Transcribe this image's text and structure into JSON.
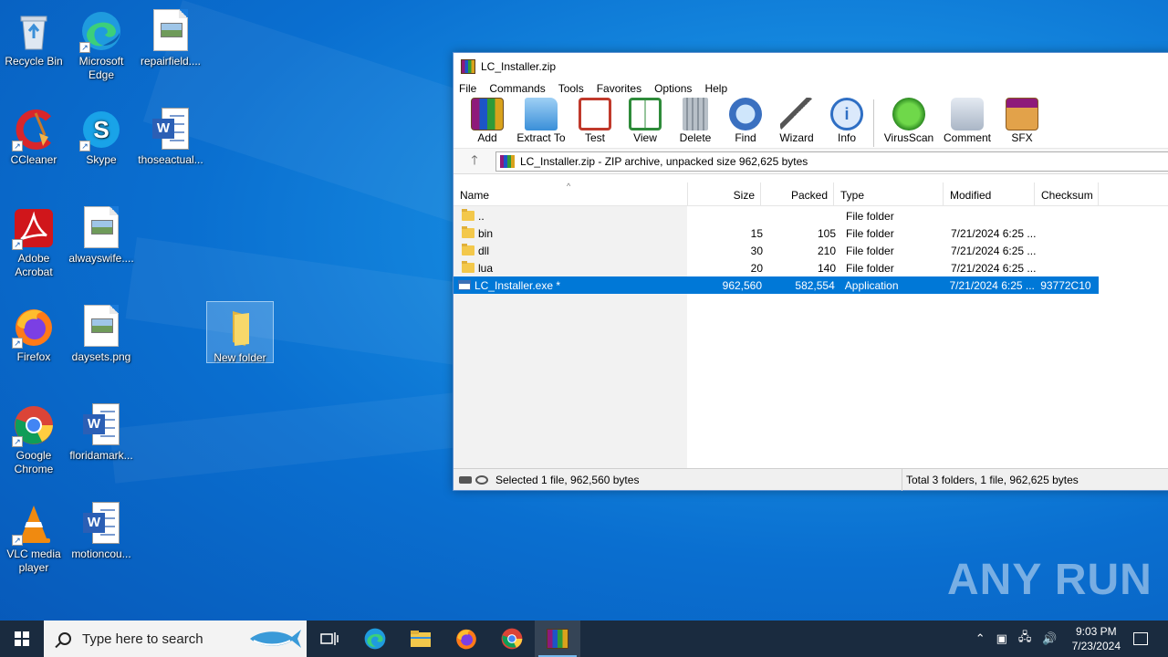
{
  "desktop": {
    "icons": [
      {
        "label": "Recycle Bin"
      },
      {
        "label": "Microsoft Edge"
      },
      {
        "label": "repairfield...."
      },
      {
        "label": "CCleaner"
      },
      {
        "label": "Skype"
      },
      {
        "label": "thoseactual..."
      },
      {
        "label": "Adobe Acrobat"
      },
      {
        "label": "alwayswife...."
      },
      {
        "label": "Firefox"
      },
      {
        "label": "daysets.png"
      },
      {
        "label": "New folder"
      },
      {
        "label": "Google Chrome"
      },
      {
        "label": "floridamark..."
      },
      {
        "label": "VLC media player"
      },
      {
        "label": "motioncou..."
      }
    ]
  },
  "window": {
    "title": "LC_Installer.zip",
    "menu": [
      "File",
      "Commands",
      "Tools",
      "Favorites",
      "Options",
      "Help"
    ],
    "toolbar": [
      "Add",
      "Extract To",
      "Test",
      "View",
      "Delete",
      "Find",
      "Wizard",
      "Info",
      "VirusScan",
      "Comment",
      "SFX"
    ],
    "address": "LC_Installer.zip - ZIP archive, unpacked size 962,625 bytes",
    "columns": [
      "Name",
      "Size",
      "Packed",
      "Type",
      "Modified",
      "Checksum"
    ],
    "rows": [
      {
        "name": "..",
        "size": "",
        "packed": "",
        "type": "File folder",
        "modified": "",
        "checksum": ""
      },
      {
        "name": "bin",
        "size": "15",
        "packed": "105",
        "type": "File folder",
        "modified": "7/21/2024 6:25 ...",
        "checksum": ""
      },
      {
        "name": "dll",
        "size": "30",
        "packed": "210",
        "type": "File folder",
        "modified": "7/21/2024 6:25 ...",
        "checksum": ""
      },
      {
        "name": "lua",
        "size": "20",
        "packed": "140",
        "type": "File folder",
        "modified": "7/21/2024 6:25 ...",
        "checksum": ""
      },
      {
        "name": "LC_Installer.exe *",
        "size": "962,560",
        "packed": "582,554",
        "type": "Application",
        "modified": "7/21/2024 6:25 ...",
        "checksum": "93772C10"
      }
    ],
    "status_left": "Selected 1 file, 962,560 bytes",
    "status_right": "Total 3 folders, 1 file, 962,625 bytes"
  },
  "taskbar": {
    "search_placeholder": "Type here to search",
    "time": "9:03 PM",
    "date": "7/23/2024"
  },
  "watermark": "ANY RUN"
}
